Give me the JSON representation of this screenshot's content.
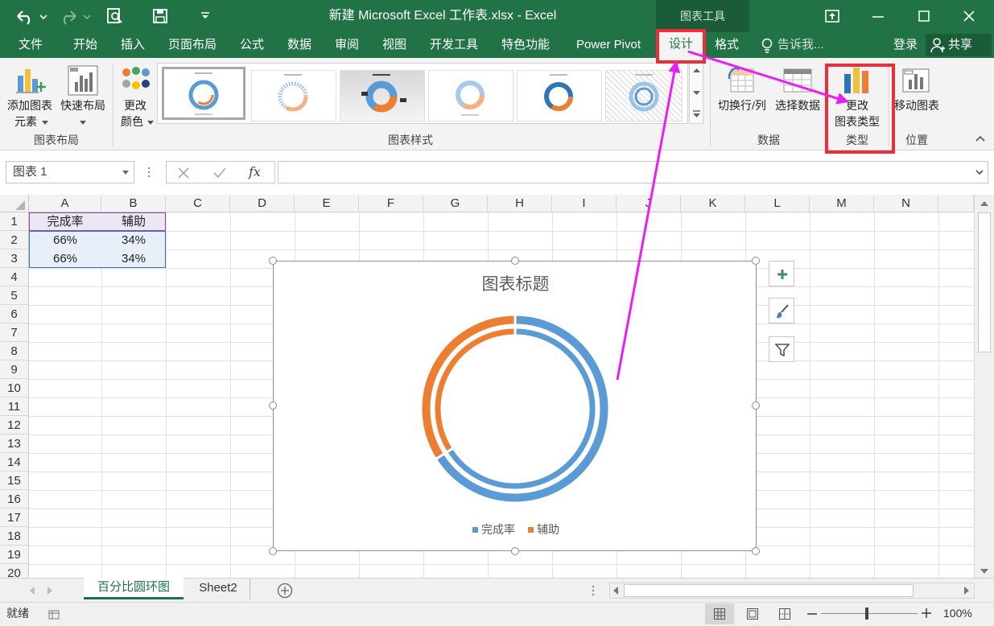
{
  "title_bar": {
    "title": "新建 Microsoft Excel 工作表.xlsx - Excel",
    "context_tool": "图表工具"
  },
  "tabs": [
    "文件",
    "开始",
    "插入",
    "页面布局",
    "公式",
    "数据",
    "审阅",
    "视图",
    "开发工具",
    "特色功能",
    "Power Pivot",
    "设计",
    "格式"
  ],
  "tell_me": "告诉我...",
  "login": "登录",
  "share": "共享",
  "ribbon": {
    "add_element": [
      "添加图表",
      "元素"
    ],
    "quick_layout": "快速布局",
    "change_color": [
      "更改",
      "颜色"
    ],
    "switch_row_col": "切换行/列",
    "select_data": "选择数据",
    "change_type": [
      "更改",
      "图表类型"
    ],
    "move_chart": "移动图表",
    "groups": {
      "layout": "图表布局",
      "styles": "图表样式",
      "data": "数据",
      "type": "类型",
      "location": "位置"
    }
  },
  "formula_bar": {
    "name_box": "图表 1",
    "fx": "fx",
    "formula": ""
  },
  "columns": [
    "A",
    "B",
    "C",
    "D",
    "E",
    "F",
    "G",
    "H",
    "I",
    "J",
    "K",
    "L",
    "M",
    "N"
  ],
  "rows": [
    "1",
    "2",
    "3",
    "4",
    "5",
    "6",
    "7",
    "8",
    "9",
    "10",
    "11",
    "12",
    "13",
    "14",
    "15",
    "16",
    "17",
    "18",
    "19",
    "20"
  ],
  "cells": [
    [
      "完成率",
      "辅助"
    ],
    [
      "66%",
      "34%"
    ],
    [
      "66%",
      "34%"
    ]
  ],
  "chart_data": {
    "type": "doughnut",
    "title": "图表标题",
    "series_labels": [
      "完成率",
      "辅助"
    ],
    "rings": [
      {
        "values": [
          0.66,
          0.34
        ]
      },
      {
        "values": [
          0.66,
          0.34
        ]
      }
    ],
    "colors": {
      "完成率": "#5b9bd5",
      "辅助": "#ed7d31"
    },
    "legend_position": "bottom"
  },
  "sheets": [
    "百分比圆环图",
    "Sheet2"
  ],
  "status": {
    "ready": "就绪",
    "zoom": "100%"
  },
  "colors": {
    "excel_green": "#217346",
    "highlight_red": "#ef2d3a",
    "arrow_magenta": "#e81ff0"
  }
}
